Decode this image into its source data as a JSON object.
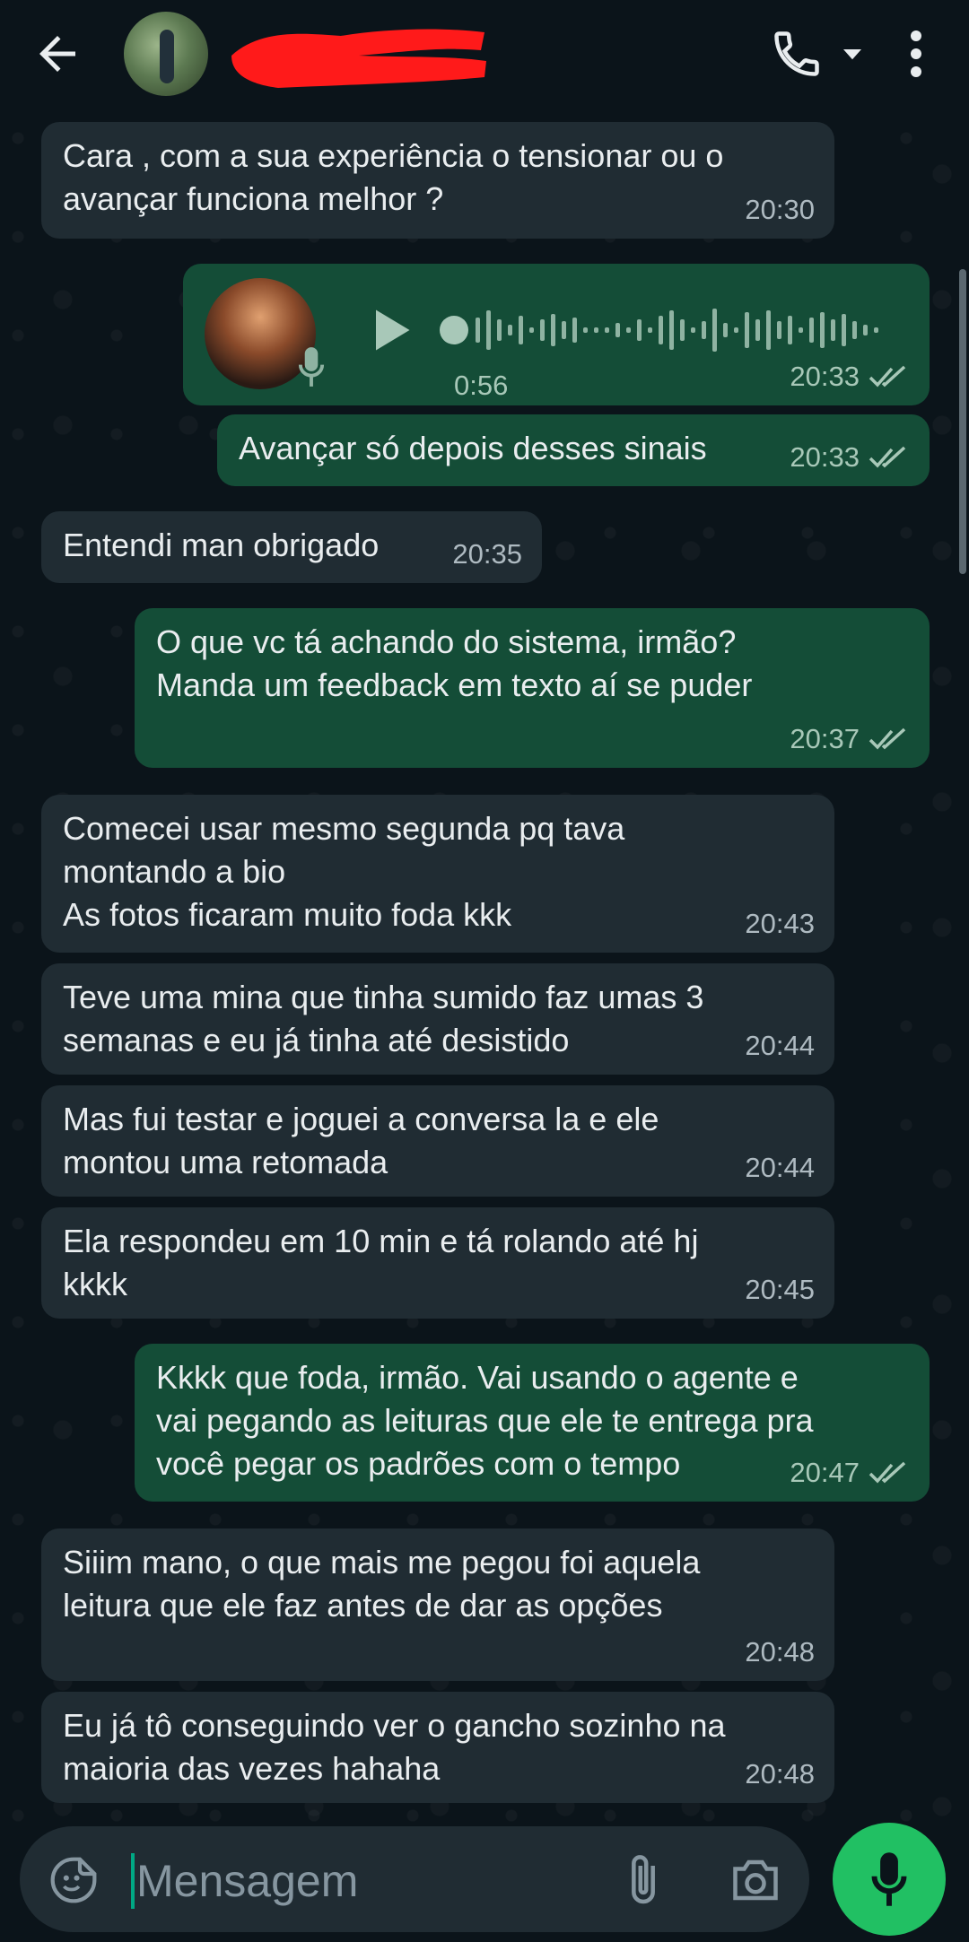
{
  "header": {
    "back": "back-arrow-icon",
    "avatar": "contact-avatar",
    "call": "phone-icon",
    "dropdown": "chevron-down-icon",
    "menu": "more-vert-icon"
  },
  "messages": [
    {
      "dir": "in",
      "text": "Cara , com a sua experiência o tensionar ou o\navançar funciona melhor ?",
      "time": "20:30"
    },
    {
      "dir": "out",
      "type": "voice",
      "duration": "0:56",
      "time": "20:33"
    },
    {
      "dir": "out",
      "text": "Avançar só depois desses sinais",
      "time": "20:33"
    },
    {
      "dir": "in",
      "text": "Entendi man obrigado",
      "time": "20:35"
    },
    {
      "dir": "out",
      "text": "O que vc tá achando do sistema, irmão?\nManda um feedback em texto aí se puder",
      "time": "20:37"
    },
    {
      "dir": "in",
      "text": "Comecei usar mesmo segunda pq tava\nmontando a bio\nAs fotos ficaram muito foda kkk",
      "time": "20:43"
    },
    {
      "dir": "in",
      "text": "Teve uma mina que tinha sumido faz umas 3\nsemanas e eu já tinha até desistido",
      "time": "20:44"
    },
    {
      "dir": "in",
      "text": "Mas fui testar e joguei a conversa la e ele\nmontou uma retomada",
      "time": "20:44"
    },
    {
      "dir": "in",
      "text": "Ela respondeu em 10 min e tá rolando até hj\nkkkk",
      "time": "20:45"
    },
    {
      "dir": "out",
      "text": "Kkkk que foda, irmão. Vai usando o agente e\nvai pegando as leituras que ele te entrega pra\nvocê pegar os padrões com o tempo",
      "time": "20:47"
    },
    {
      "dir": "in",
      "text": "Siiim mano,  o que mais me pegou foi aquela\nleitura que ele faz antes de dar as opções",
      "time": "20:48"
    },
    {
      "dir": "in",
      "text": "Eu já tô conseguindo ver o gancho sozinho na\nmaioria das vezes hahaha",
      "time": "20:48"
    }
  ],
  "composer": {
    "placeholder": "Mensagem",
    "emoji": "emoji-sticker-icon",
    "attach": "paperclip-icon",
    "camera": "camera-icon",
    "mic": "mic-icon"
  },
  "colors": {
    "background": "#0b141a",
    "incoming_bubble": "#202c33",
    "outgoing_bubble": "#144d37",
    "accent": "#21c063"
  }
}
